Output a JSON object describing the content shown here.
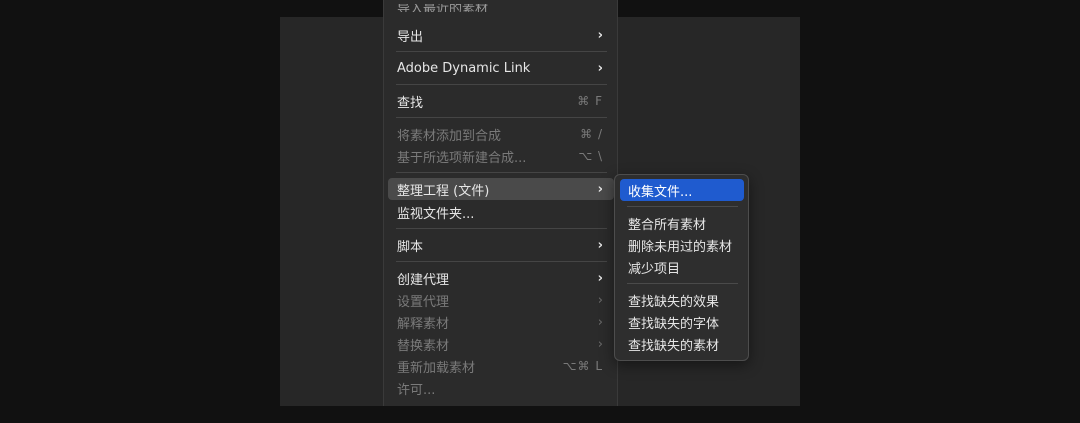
{
  "menu": {
    "cut_top": "导入最近的素材",
    "items": {
      "export": {
        "label": "导出",
        "chevron": "›"
      },
      "dynamic_link": {
        "label": "Adobe Dynamic Link",
        "chevron": "›"
      },
      "find": {
        "label": "查找",
        "shortcut": "⌘ F"
      },
      "add_to_comp": {
        "label": "将素材添加到合成",
        "shortcut": "⌘ /"
      },
      "new_comp_from_selection": {
        "label": "基于所选项新建合成...",
        "shortcut": "⌥ \\"
      },
      "dependencies": {
        "label": "整理工程 (文件)",
        "chevron": "›"
      },
      "watch_folder": {
        "label": "监视文件夹..."
      },
      "scripts": {
        "label": "脚本",
        "chevron": "›"
      },
      "create_proxy": {
        "label": "创建代理",
        "chevron": "›"
      },
      "set_proxy": {
        "label": "设置代理",
        "chevron": "›"
      },
      "interpret_footage": {
        "label": "解释素材",
        "chevron": "›"
      },
      "replace_footage": {
        "label": "替换素材",
        "chevron": "›"
      },
      "reload_footage": {
        "label": "重新加载素材",
        "shortcut": "⌥⌘ L"
      },
      "license": {
        "label": "许可..."
      }
    }
  },
  "submenu": {
    "collect_files": "收集文件...",
    "consolidate": "整合所有素材",
    "remove_unused": "删除未用过的素材",
    "reduce_project": "减少项目",
    "find_missing_effects": "查找缺失的效果",
    "find_missing_fonts": "查找缺失的字体",
    "find_missing_footage": "查找缺失的素材"
  }
}
